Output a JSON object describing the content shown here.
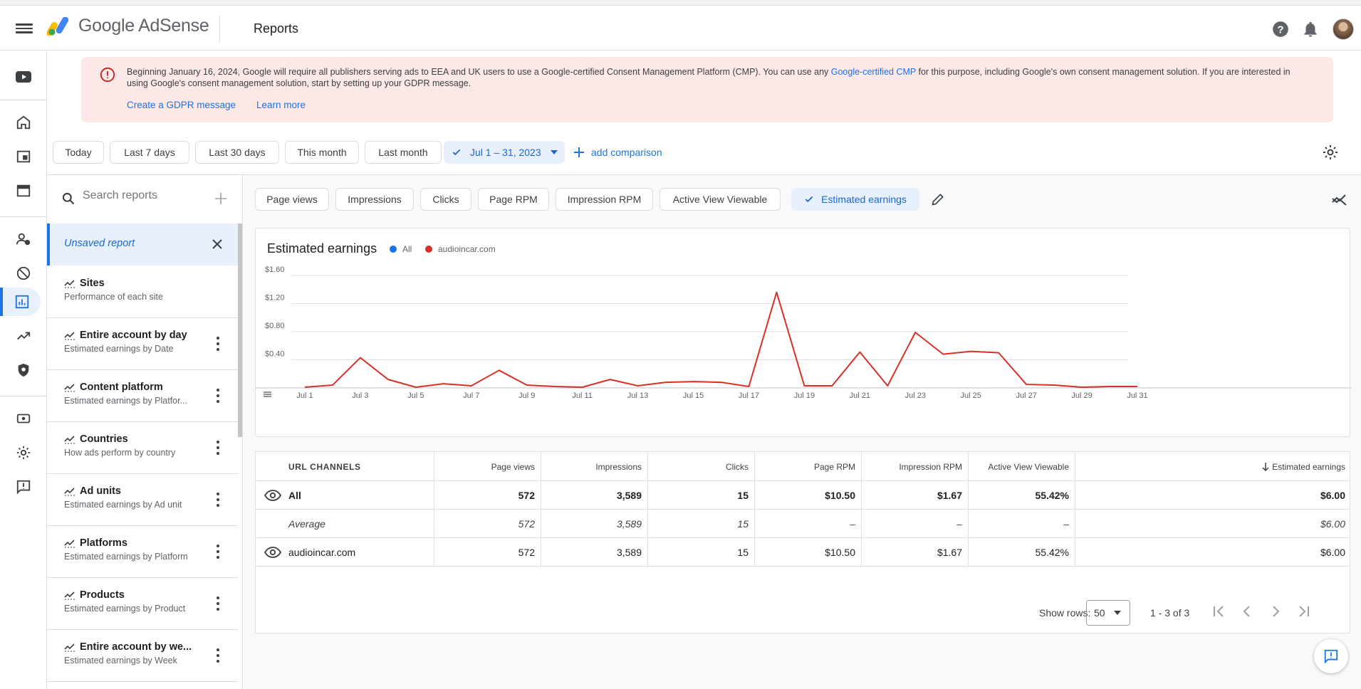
{
  "header": {
    "product_name": "Google AdSense",
    "page_title": "Reports"
  },
  "banner": {
    "text_before_link": "Beginning January 16, 2024, Google will require all publishers serving ads to EEA and UK users to use a Google-certified Consent Management Platform (CMP). You can use any ",
    "inline_link": "Google-certified CMP",
    "text_after_link": " for this purpose, including Google's own consent management solution. If you are interested in using Google's consent management solution, start by setting up your GDPR message.",
    "link_create": "Create a GDPR message",
    "link_learn": "Learn more"
  },
  "date_filters": {
    "today": "Today",
    "last7": "Last 7 days",
    "last30": "Last 30 days",
    "this_month": "This month",
    "last_month": "Last month",
    "selected_range": "Jul 1 – 31, 2023",
    "add_comparison": "add comparison"
  },
  "sidebar": {
    "search_placeholder": "Search reports",
    "unsaved_label": "Unsaved report",
    "reports": [
      {
        "title": "Sites",
        "subtitle": "Performance of each site"
      },
      {
        "title": "Entire account by day",
        "subtitle": "Estimated earnings by Date"
      },
      {
        "title": "Content platform",
        "subtitle": "Estimated earnings by Platfor..."
      },
      {
        "title": "Countries",
        "subtitle": "How ads perform by country"
      },
      {
        "title": "Ad units",
        "subtitle": "Estimated earnings by Ad unit"
      },
      {
        "title": "Platforms",
        "subtitle": "Estimated earnings by Platform"
      },
      {
        "title": "Products",
        "subtitle": "Estimated earnings by Product"
      },
      {
        "title": "Entire account by we...",
        "subtitle": "Estimated earnings by Week"
      }
    ]
  },
  "metrics": {
    "page_views": "Page views",
    "impressions": "Impressions",
    "clicks": "Clicks",
    "page_rpm": "Page RPM",
    "impression_rpm": "Impression RPM",
    "active_view": "Active View Viewable",
    "estimated_earnings": "Estimated earnings"
  },
  "chart_data": {
    "type": "line",
    "title": "Estimated earnings",
    "x": [
      "Jul 1",
      "Jul 2",
      "Jul 3",
      "Jul 4",
      "Jul 5",
      "Jul 6",
      "Jul 7",
      "Jul 8",
      "Jul 9",
      "Jul 10",
      "Jul 11",
      "Jul 12",
      "Jul 13",
      "Jul 14",
      "Jul 15",
      "Jul 16",
      "Jul 17",
      "Jul 18",
      "Jul 19",
      "Jul 20",
      "Jul 21",
      "Jul 22",
      "Jul 23",
      "Jul 24",
      "Jul 25",
      "Jul 26",
      "Jul 27",
      "Jul 28",
      "Jul 29",
      "Jul 30",
      "Jul 31"
    ],
    "x_tick_labels": [
      "Jul 1",
      "Jul 3",
      "Jul 5",
      "Jul 7",
      "Jul 9",
      "Jul 11",
      "Jul 13",
      "Jul 15",
      "Jul 17",
      "Jul 19",
      "Jul 21",
      "Jul 23",
      "Jul 25",
      "Jul 27",
      "Jul 29",
      "Jul 31"
    ],
    "y_tick_labels": [
      "$0.40",
      "$0.80",
      "$1.20",
      "$1.60"
    ],
    "y_ticks": [
      0.4,
      0.8,
      1.2,
      1.6
    ],
    "ylim": [
      0,
      1.7
    ],
    "legend": [
      "All",
      "audioincar.com"
    ],
    "series": [
      {
        "name": "audioincar.com",
        "color": "#d93025",
        "values": [
          0.01,
          0.04,
          0.43,
          0.12,
          0.01,
          0.06,
          0.03,
          0.25,
          0.04,
          0.02,
          0.01,
          0.12,
          0.03,
          0.08,
          0.09,
          0.08,
          0.02,
          1.36,
          0.03,
          0.03,
          0.51,
          0.03,
          0.79,
          0.48,
          0.52,
          0.5,
          0.05,
          0.04,
          0.01,
          0.02,
          0.02
        ]
      }
    ],
    "grid": true,
    "legend_placement": "top-left"
  },
  "legend_colors": {
    "all": "#1a73e8",
    "site": "#d93025"
  },
  "table": {
    "header_first": "URL CHANNELS",
    "columns": [
      "Page views",
      "Impressions",
      "Clicks",
      "Page RPM",
      "Impression RPM",
      "Active View Viewable",
      "Estimated earnings"
    ],
    "rows": [
      {
        "label": "All",
        "values": [
          "572",
          "3,589",
          "15",
          "$10.50",
          "$1.67",
          "55.42%",
          "$6.00"
        ]
      },
      {
        "label": "Average",
        "values": [
          "572",
          "3,589",
          "15",
          "–",
          "–",
          "–",
          "$6.00"
        ]
      },
      {
        "label": "audioincar.com",
        "values": [
          "572",
          "3,589",
          "15",
          "$10.50",
          "$1.67",
          "55.42%",
          "$6.00"
        ]
      }
    ]
  },
  "pager": {
    "show_rows_label": "Show rows:",
    "rows_value": "50",
    "range_text": "1 - 3 of 3"
  }
}
